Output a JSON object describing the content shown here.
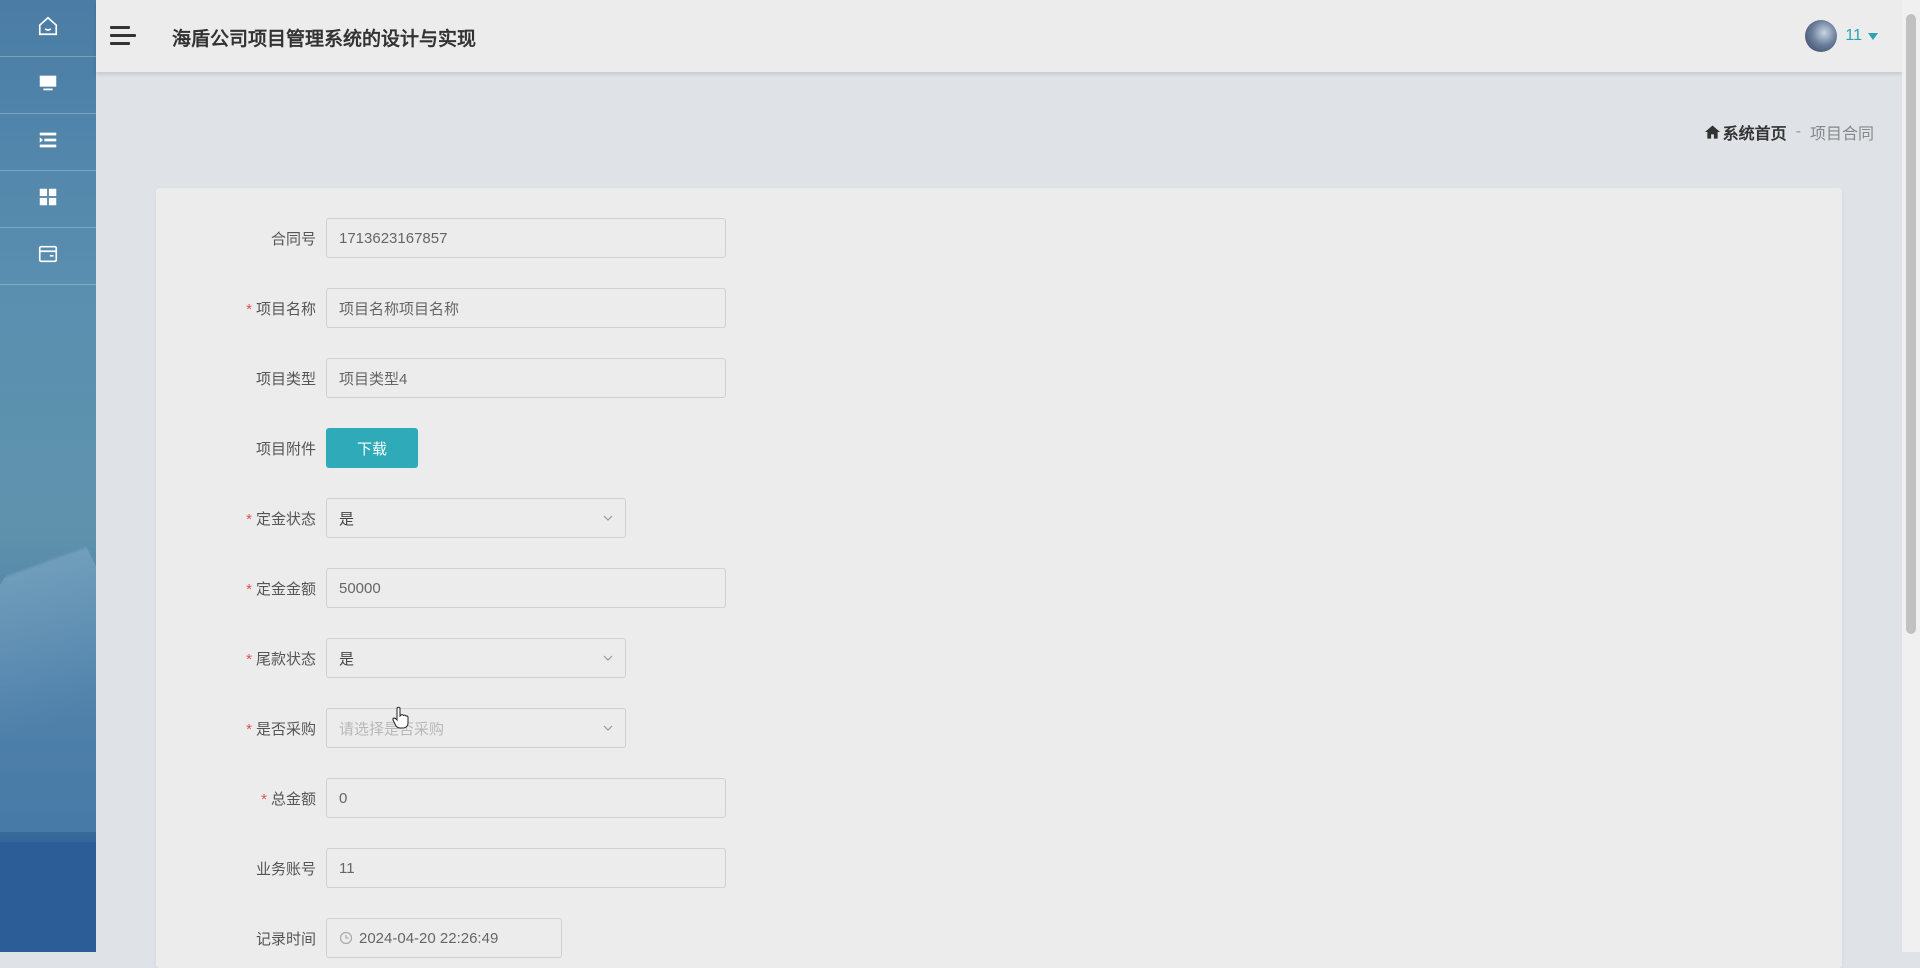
{
  "header": {
    "title": "海盾公司项目管理系统的设计与实现",
    "user_name": "11"
  },
  "sidebar": {
    "items": [
      {
        "icon": "home-icon"
      },
      {
        "icon": "monitor-icon"
      },
      {
        "icon": "list-icon"
      },
      {
        "icon": "grid-icon"
      },
      {
        "icon": "card-icon"
      }
    ]
  },
  "breadcrumb": {
    "home": "系统首页",
    "separator": "-",
    "current": "项目合同"
  },
  "form": {
    "contract_no": {
      "label": "合同号",
      "value": "1713623167857"
    },
    "project_name": {
      "label": "项目名称",
      "value": "项目名称项目名称"
    },
    "project_type": {
      "label": "项目类型",
      "value": "项目类型4"
    },
    "attachment": {
      "label": "项目附件",
      "button": "下载"
    },
    "deposit_status": {
      "label": "定金状态",
      "value": "是"
    },
    "deposit_amount": {
      "label": "定金金额",
      "value": "50000"
    },
    "final_status": {
      "label": "尾款状态",
      "value": "是"
    },
    "purchase": {
      "label": "是否采购",
      "placeholder": "请选择是否采购"
    },
    "total_amount": {
      "label": "总金额",
      "value": "0"
    },
    "account": {
      "label": "业务账号",
      "value": "11"
    },
    "record_time": {
      "label": "记录时间",
      "value": "2024-04-20 22:26:49"
    }
  },
  "required_mark": "*",
  "colors": {
    "accent": "#2eaab9",
    "required": "#e05454"
  }
}
